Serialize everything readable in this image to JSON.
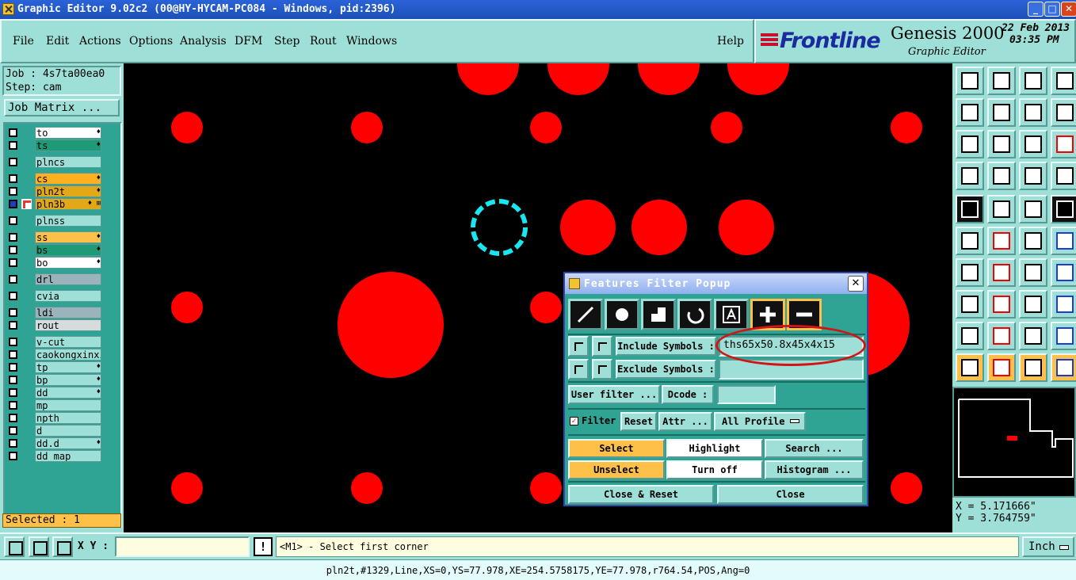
{
  "window": {
    "title": "Graphic Editor 9.02c2 (00@HY-HYCAM-PC084 - Windows, pid:2396)",
    "minimize": "_",
    "maximize": "□",
    "close": "✕"
  },
  "menu": {
    "items": [
      "File",
      "Edit",
      "Actions",
      "Options",
      "Analysis",
      "DFM",
      "Step",
      "Rout",
      "Windows"
    ],
    "help": "Help"
  },
  "brand": {
    "name": "Frontline",
    "product": "Genesis 2000",
    "subtitle": "Graphic Editor",
    "date": "22 Feb 2013",
    "time": "03:35 PM"
  },
  "job": {
    "job_line": "Job : 4s7ta00ea0",
    "step_line": "Step: cam",
    "job_matrix": "Job Matrix ..."
  },
  "layers": [
    {
      "name": "to",
      "color": "#ffffff",
      "mark": "♦"
    },
    {
      "name": "ts",
      "color": "#1f9a76",
      "mark": "♦"
    },
    {
      "name": "plncs",
      "color": "#9ee0d8",
      "mark": ""
    },
    {
      "name": "cs",
      "color": "#ffb020",
      "mark": "♦"
    },
    {
      "name": "pln2t",
      "color": "#e2a818",
      "mark": "♦"
    },
    {
      "name": "pln3b",
      "color": "#e2a818",
      "mark": "♦ ⊞"
    },
    {
      "name": "plnss",
      "color": "#9ee0d8",
      "mark": ""
    },
    {
      "name": "ss",
      "color": "#ffc04a",
      "mark": "♦"
    },
    {
      "name": "bs",
      "color": "#1f9a76",
      "mark": "♦"
    },
    {
      "name": "bo",
      "color": "#ffffff",
      "mark": "♦"
    },
    {
      "name": "drl",
      "color": "#9bb4bb",
      "mark": ""
    },
    {
      "name": "cvia",
      "color": "#9ee0d8",
      "mark": ""
    },
    {
      "name": "ldi",
      "color": "#9bb4bb",
      "mark": ""
    },
    {
      "name": "rout",
      "color": "#d6dcdc",
      "mark": ""
    },
    {
      "name": "v-cut",
      "color": "#9ee0d8",
      "mark": ""
    },
    {
      "name": "caokongxinxi",
      "color": "#9ee0d8",
      "mark": ""
    },
    {
      "name": "tp",
      "color": "#9ee0d8",
      "mark": "♦"
    },
    {
      "name": "bp",
      "color": "#9ee0d8",
      "mark": "♦"
    },
    {
      "name": "dd",
      "color": "#9ee0d8",
      "mark": "♦"
    },
    {
      "name": "mp",
      "color": "#9ee0d8",
      "mark": ""
    },
    {
      "name": "npth",
      "color": "#9ee0d8",
      "mark": ""
    },
    {
      "name": "d",
      "color": "#9ee0d8",
      "mark": ""
    },
    {
      "name": "dd.d",
      "color": "#9ee0d8",
      "mark": "♦"
    },
    {
      "name": "dd_map",
      "color": "#9ee0d8",
      "mark": ""
    }
  ],
  "selected_count": "Selected : 1",
  "coordinates": {
    "x_line": "X = 5.171666\"",
    "y_line": "Y = 3.764759\""
  },
  "bottom": {
    "xy_label": "X Y :",
    "xy_value": "",
    "alert": "!",
    "prompt": "<M1> - Select first corner",
    "units": "Inch"
  },
  "status_line": "pln2t,#1329,Line,XS=0,YS=77.978,XE=254.5758175,YE=77.978,r764.54,POS,Ang=0",
  "popup": {
    "title": "Features Filter Popup",
    "close": "✕",
    "tool_icons": [
      "line-icon",
      "pad-icon",
      "surface-icon",
      "arc-icon",
      "text-icon",
      "positive-icon",
      "negative-icon"
    ],
    "include_label": "Include Symbols :",
    "include_value": "ths65x50.8x45x4x15",
    "exclude_label": "Exclude Symbols :",
    "exclude_value": "",
    "user_filter": "User filter ...",
    "dcode_label": "Dcode :",
    "dcode_value": "",
    "filter_label": "Filter",
    "reset": "Reset",
    "attr": "Attr ...",
    "profile": "All Profile",
    "select": "Select",
    "highlight": "Highlight",
    "search": "Search ...",
    "unselect": "Unselect",
    "turn_off": "Turn off",
    "histogram": "Histogram ...",
    "close_reset": "Close & Reset",
    "close_btn": "Close"
  }
}
